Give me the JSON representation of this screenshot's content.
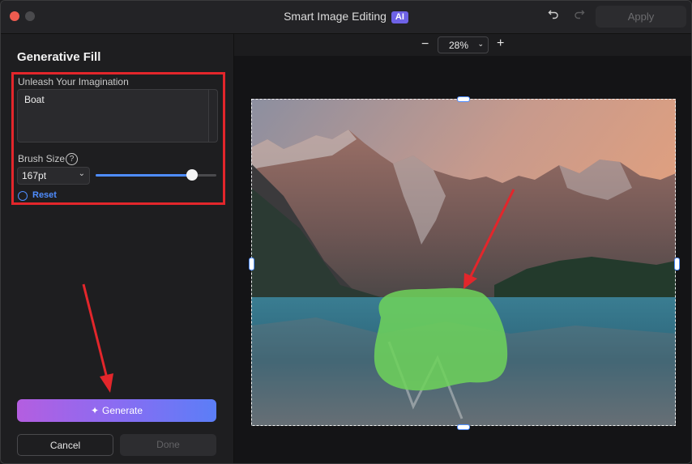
{
  "window": {
    "title": "Smart Image Editing",
    "ai_badge": "AI",
    "apply_label": "Apply"
  },
  "sidebar": {
    "panel_title": "Generative Fill",
    "prompt_label": "Unleash Your Imagination",
    "prompt_value": "Boat",
    "brush_label": "Brush Size",
    "brush_value": "167pt",
    "brush_level_fraction": 0.8,
    "help_glyph": "?",
    "reset_label": "Reset",
    "generate_label": "Generate",
    "cancel_label": "Cancel",
    "done_label": "Done"
  },
  "canvas": {
    "zoom_value": "28%",
    "zoom_minus": "−",
    "zoom_plus": "+"
  },
  "colors": {
    "accent": "#4f8dff",
    "annotation_red": "#e3262b",
    "mask_green": "#6fd45a"
  },
  "icons": [
    "undo-icon",
    "redo-icon",
    "help-icon",
    "chevron-down-icon",
    "reset-icon",
    "sparkle-icon"
  ]
}
